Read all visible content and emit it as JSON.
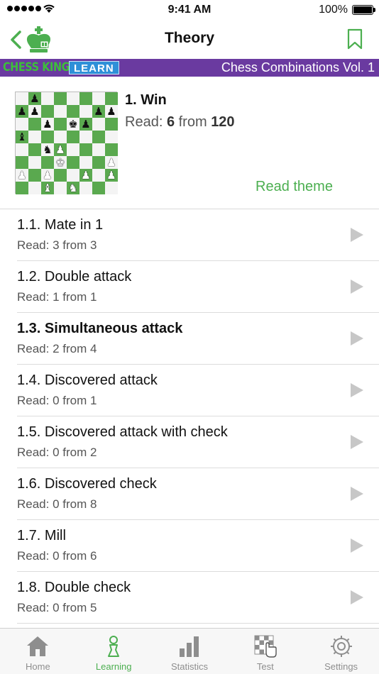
{
  "status_bar": {
    "time": "9:41 AM",
    "battery": "100%"
  },
  "nav": {
    "title": "Theory"
  },
  "banner": {
    "brand": "CHESS KING",
    "learn": "LEARN",
    "course": "Chess Combinations Vol. 1"
  },
  "theme": {
    "title": "1. Win",
    "read_prefix": "Read: ",
    "read_done": "6",
    "read_middle": " from ",
    "read_total": "120",
    "read_theme_link": "Read theme"
  },
  "board": {
    "ranks": [
      [
        "",
        "p",
        "",
        "",
        "",
        "",
        "",
        ""
      ],
      [
        "p",
        "p",
        "",
        "",
        "",
        "",
        "p",
        "p"
      ],
      [
        "",
        "",
        "p",
        "",
        "k",
        "p",
        "",
        ""
      ],
      [
        "b",
        "",
        "",
        "",
        "",
        "",
        "",
        ""
      ],
      [
        "",
        "",
        "n",
        "P",
        "",
        "",
        "",
        ""
      ],
      [
        "",
        "",
        "",
        "K",
        "",
        "",
        "",
        "P"
      ],
      [
        "P",
        "",
        "P",
        "",
        "",
        "P",
        "",
        "P"
      ],
      [
        "",
        "",
        "B",
        "",
        "N",
        "",
        "",
        ""
      ]
    ]
  },
  "lessons": [
    {
      "title": "1.1. Mate in 1",
      "read": "Read: 3 from 3",
      "bold": false
    },
    {
      "title": "1.2. Double attack",
      "read": "Read: 1 from 1",
      "bold": false
    },
    {
      "title": "1.3. Simultaneous attack",
      "read": "Read: 2 from 4",
      "bold": true
    },
    {
      "title": "1.4. Discovered attack",
      "read": "Read: 0 from 1",
      "bold": false
    },
    {
      "title": "1.5. Discovered attack with check",
      "read": "Read: 0 from 2",
      "bold": false
    },
    {
      "title": "1.6. Discovered check",
      "read": "Read: 0 from 8",
      "bold": false
    },
    {
      "title": "1.7. Mill",
      "read": "Read: 0 from 6",
      "bold": false
    },
    {
      "title": "1.8. Double check",
      "read": "Read: 0 from 5",
      "bold": false
    }
  ],
  "tabs": [
    {
      "label": "Home",
      "icon": "home-icon"
    },
    {
      "label": "Learning",
      "icon": "learning-icon",
      "active": true
    },
    {
      "label": "Statistics",
      "icon": "statistics-icon"
    },
    {
      "label": "Test",
      "icon": "test-icon"
    },
    {
      "label": "Settings",
      "icon": "settings-icon"
    }
  ],
  "colors": {
    "accent": "#4caf50",
    "banner": "#6a3aa0",
    "board_dark": "#5aa94f",
    "learn_badge": "#2e90d8"
  }
}
